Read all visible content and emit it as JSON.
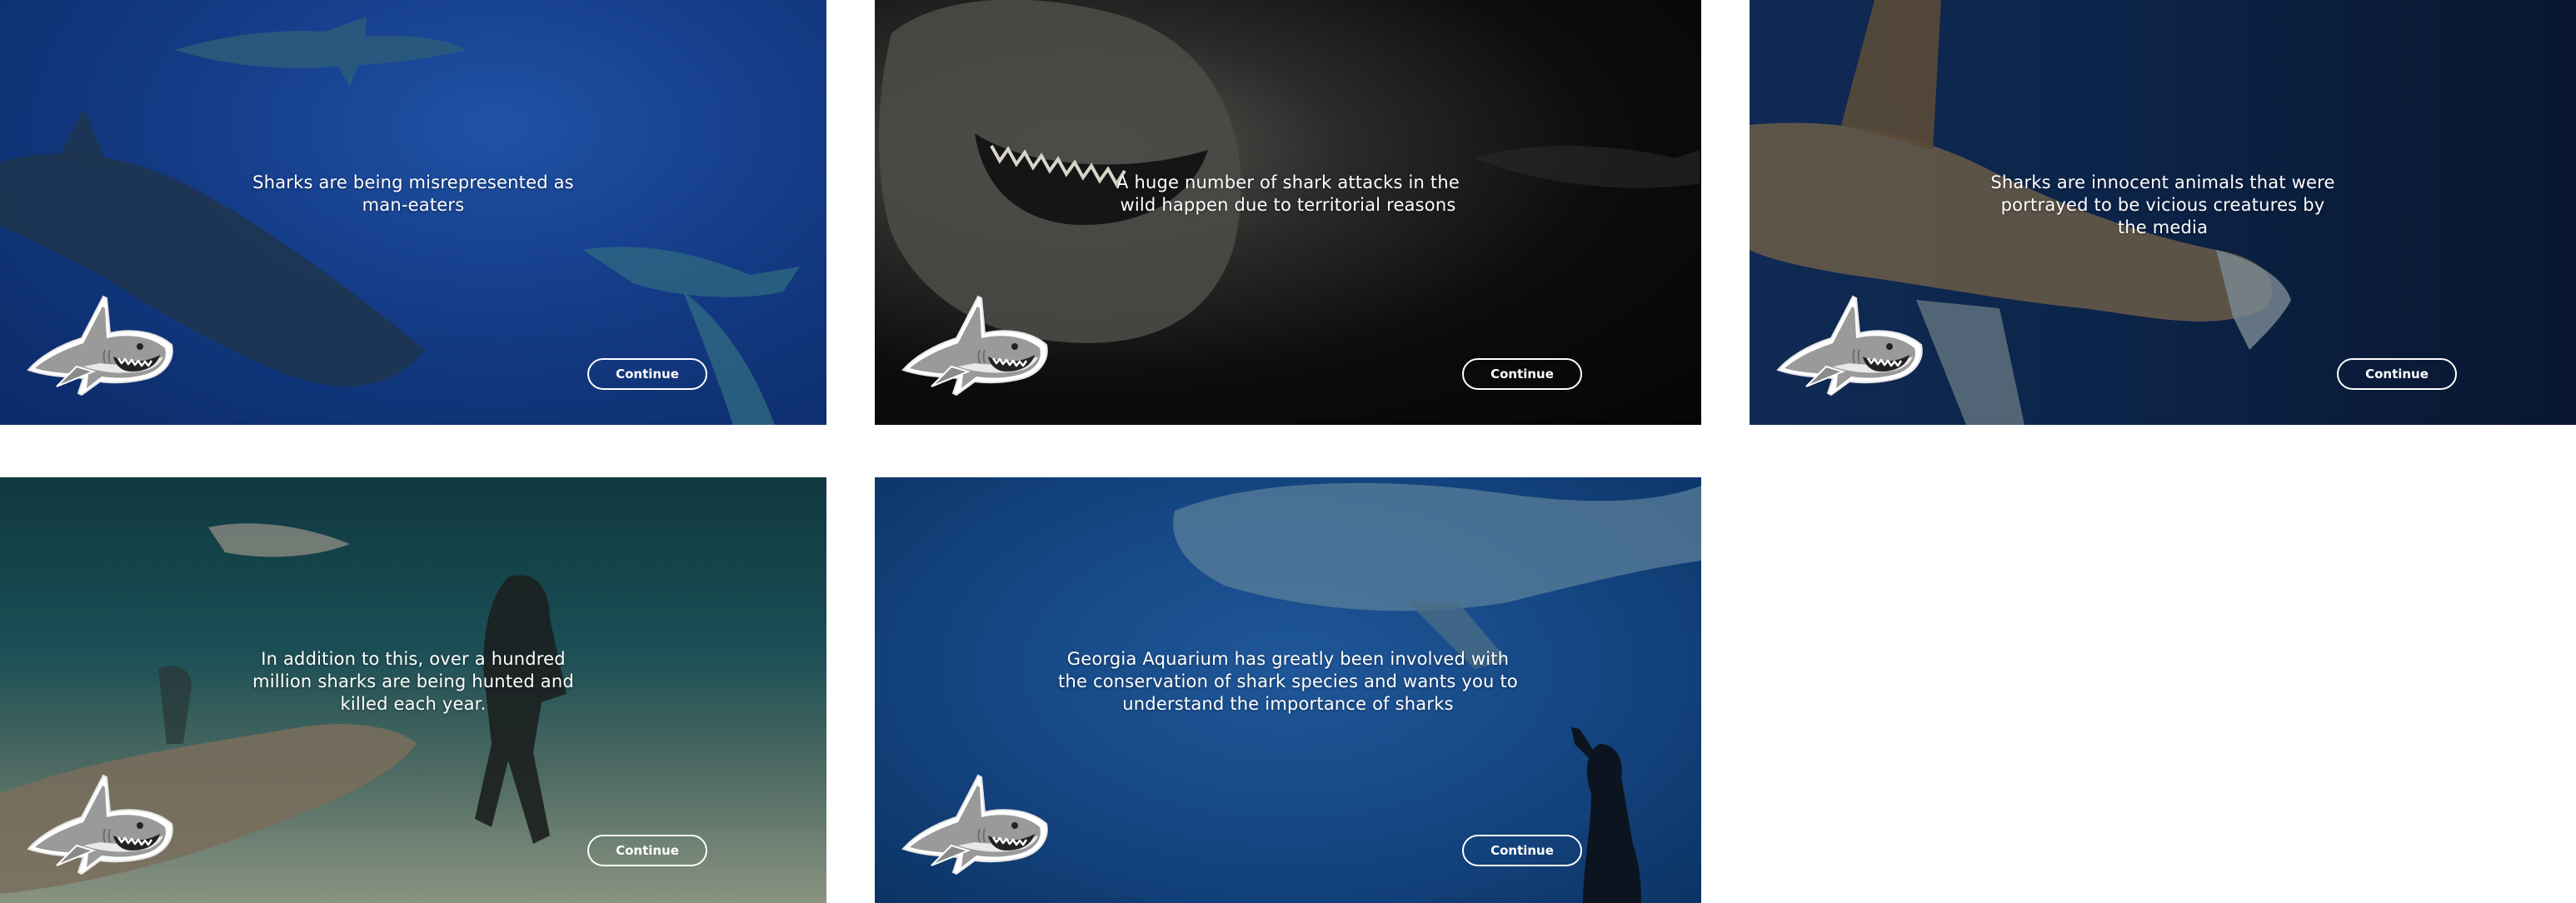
{
  "slides": [
    {
      "caption": "Sharks are being misrepresented as man-eaters",
      "button_label": "Continue"
    },
    {
      "caption": "A huge number of shark attacks in the wild happen due to territorial reasons",
      "button_label": "Continue"
    },
    {
      "caption": "Sharks are innocent animals that were portrayed to be vicious creatures by the media",
      "button_label": "Continue"
    },
    {
      "caption": "In addition to this, over a hundred million sharks are being hunted and killed each year.",
      "button_label": "Continue"
    },
    {
      "caption": "Georgia Aquarium has greatly been involved with the conservation of shark species and wants you to understand the importance of sharks",
      "button_label": "Continue"
    }
  ],
  "icons": {
    "mascot": "shark-mascot-icon"
  },
  "colors": {
    "text": "#ffffff",
    "button_border": "#ffffff",
    "page_background": "#ffffff"
  }
}
